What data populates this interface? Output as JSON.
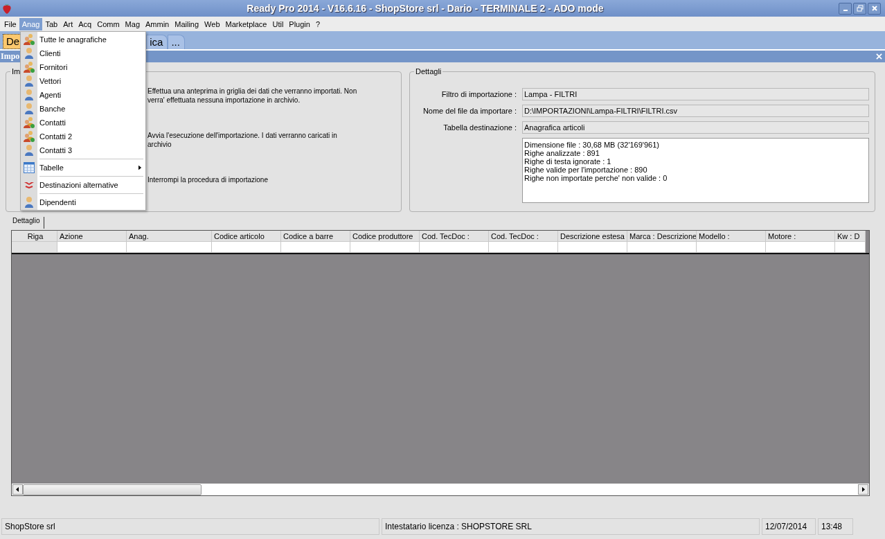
{
  "window": {
    "title": "Ready Pro 2014 - V16.6.16 - ShopStore srl - Dario - TERMINALE 2 - ADO mode"
  },
  "menu_bar": [
    {
      "label": "File",
      "selected": false
    },
    {
      "label": "Anag",
      "selected": true
    },
    {
      "label": "Tab",
      "selected": false
    },
    {
      "label": "Art",
      "selected": false
    },
    {
      "label": "Acq",
      "selected": false
    },
    {
      "label": "Comm",
      "selected": false
    },
    {
      "label": "Mag",
      "selected": false
    },
    {
      "label": "Ammin",
      "selected": false
    },
    {
      "label": "Mailing",
      "selected": false
    },
    {
      "label": "Web",
      "selected": false
    },
    {
      "label": "Marketplace",
      "selected": false
    },
    {
      "label": "Util",
      "selected": false
    },
    {
      "label": "Plugin",
      "selected": false
    },
    {
      "label": "?",
      "selected": false
    }
  ],
  "open_menu": {
    "items": [
      {
        "kind": "people",
        "label": "Tutte le anagrafiche",
        "submenu": false
      },
      {
        "kind": "person",
        "label": "Clienti",
        "submenu": false
      },
      {
        "kind": "people",
        "label": "Fornitori",
        "submenu": false
      },
      {
        "kind": "person",
        "label": "Vettori",
        "submenu": false
      },
      {
        "kind": "person",
        "label": "Agenti",
        "submenu": false
      },
      {
        "kind": "person",
        "label": "Banche",
        "submenu": false
      },
      {
        "kind": "people",
        "label": "Contatti",
        "submenu": false
      },
      {
        "kind": "people",
        "label": "Contatti 2",
        "submenu": false
      },
      {
        "kind": "person",
        "label": "Contatti 3",
        "submenu": false
      },
      {
        "kind": "separator"
      },
      {
        "kind": "table",
        "label": "Tabelle",
        "submenu": true
      },
      {
        "kind": "separator"
      },
      {
        "kind": "arrows",
        "label": "Destinazioni alternative",
        "submenu": false
      },
      {
        "kind": "separator"
      },
      {
        "kind": "person",
        "label": "Dipendenti",
        "submenu": false
      }
    ]
  },
  "doc_tabs": [
    {
      "label": "De",
      "selected": true
    },
    {
      "label": "ica",
      "selected": false
    },
    {
      "label": "...",
      "selected": false
    }
  ],
  "panel": {
    "title": "Impo"
  },
  "actions_group": {
    "title": "Im",
    "descriptions": [
      "Effettua una anteprima in griglia dei dati che verranno importati. Non\nverra' effettuata nessuna importazione in archivio.",
      "Avvia l'esecuzione dell'importazione. I dati verranno caricati in\narchivio",
      "Interrompi la procedura di importazione"
    ]
  },
  "details": {
    "title": "Dettagli",
    "fields": [
      {
        "label": "Filtro di importazione :",
        "value": "Lampa - FILTRI"
      },
      {
        "label": "Nome del file da importare :",
        "value": "D:\\IMPORTAZIONI\\Lampa-FILTRI\\FILTRI.csv"
      },
      {
        "label": "Tabella destinazione :",
        "value": "Anagrafica articoli"
      }
    ],
    "log": [
      "Dimensione file : 30,68 MB (32'169'961)",
      "Righe analizzate : 891",
      "Righe di testa ignorate : 1",
      "Righe valide per l'importazione : 890",
      "Righe non importate perche' non valide : 0"
    ]
  },
  "detail_tab": {
    "label": "Dettaglio"
  },
  "grid": {
    "columns": [
      "Riga",
      "Azione",
      "Anag.",
      "Codice articolo",
      "Codice a barre",
      "Codice produttore",
      "Cod. TecDoc :",
      "Cod. TecDoc :",
      "Descrizione estesa",
      "Marca : Descrizione",
      "Modello :",
      "Motore :",
      "Kw : D"
    ]
  },
  "status_bar": [
    "ShopStore srl",
    "Intestatario licenza : SHOPSTORE SRL",
    "12/07/2014",
    "13:48"
  ]
}
